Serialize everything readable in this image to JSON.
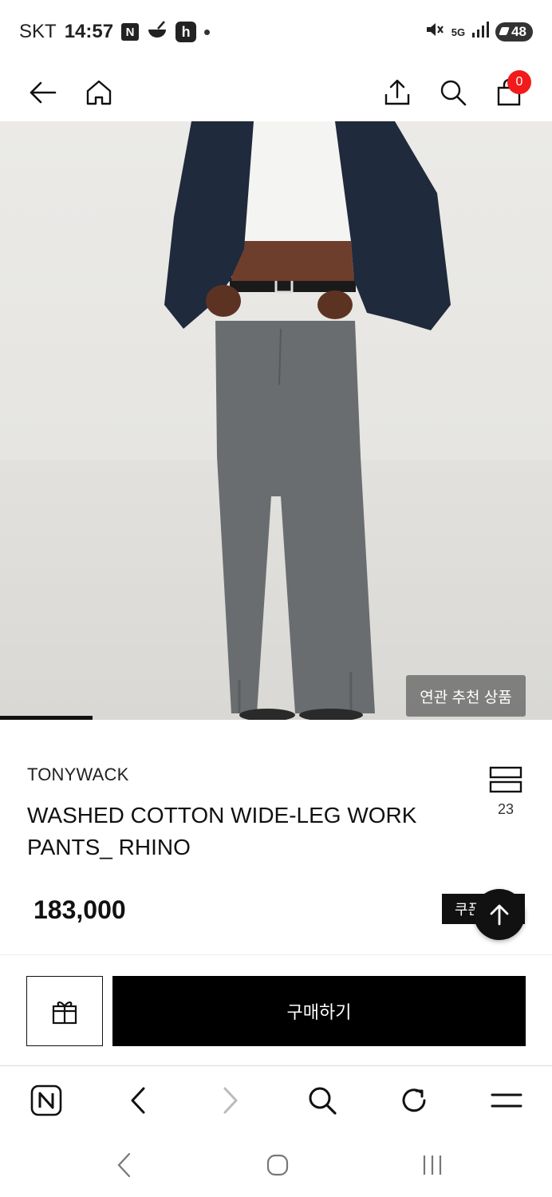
{
  "status_bar": {
    "carrier": "SKT",
    "time": "14:57",
    "badge_n": "N",
    "badge_h": "h",
    "network": "5G",
    "battery": "48"
  },
  "top_nav": {
    "cart_count": "0"
  },
  "hero": {
    "related_label": "연관 추천 상품",
    "image_index": 1
  },
  "product": {
    "brand": "TONYWACK",
    "name": "WASHED COTTON WIDE-LEG WORK PANTS_ RHINO",
    "price": "183,000",
    "layers_count": "23",
    "coupon_label": "쿠폰"
  },
  "purchase": {
    "buy_label": "구매하기"
  },
  "browser_bar": {
    "items": [
      "naver-home",
      "back",
      "forward",
      "search",
      "refresh",
      "menu"
    ]
  },
  "colors": {
    "cart_badge": "#f21a1a",
    "primary_button": "#000000"
  }
}
